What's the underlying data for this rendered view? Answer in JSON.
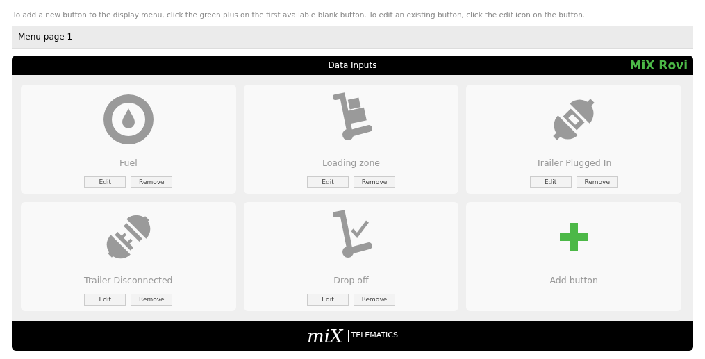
{
  "instructions": "To add a new button to the display menu, click the green plus on the first available blank button. To edit an existing button, click the edit icon on the button.",
  "menu_page": {
    "title": "Menu page 1"
  },
  "panel": {
    "title": "Data Inputs",
    "brand": "MiX Rovi"
  },
  "buttons": [
    {
      "kind": "fuel",
      "label": "Fuel",
      "actions": [
        "Edit",
        "Remove"
      ]
    },
    {
      "kind": "loading",
      "label": "Loading zone",
      "actions": [
        "Edit",
        "Remove"
      ]
    },
    {
      "kind": "plugged",
      "label": "Trailer Plugged In",
      "actions": [
        "Edit",
        "Remove"
      ]
    },
    {
      "kind": "unplugged",
      "label": "Trailer Disconnected",
      "actions": [
        "Edit",
        "Remove"
      ]
    },
    {
      "kind": "dropoff",
      "label": "Drop off",
      "actions": [
        "Edit",
        "Remove"
      ]
    },
    {
      "kind": "add",
      "label": "Add button"
    }
  ],
  "footer": {
    "logo_mark": "miX",
    "logo_text": "TELEMATICS"
  }
}
